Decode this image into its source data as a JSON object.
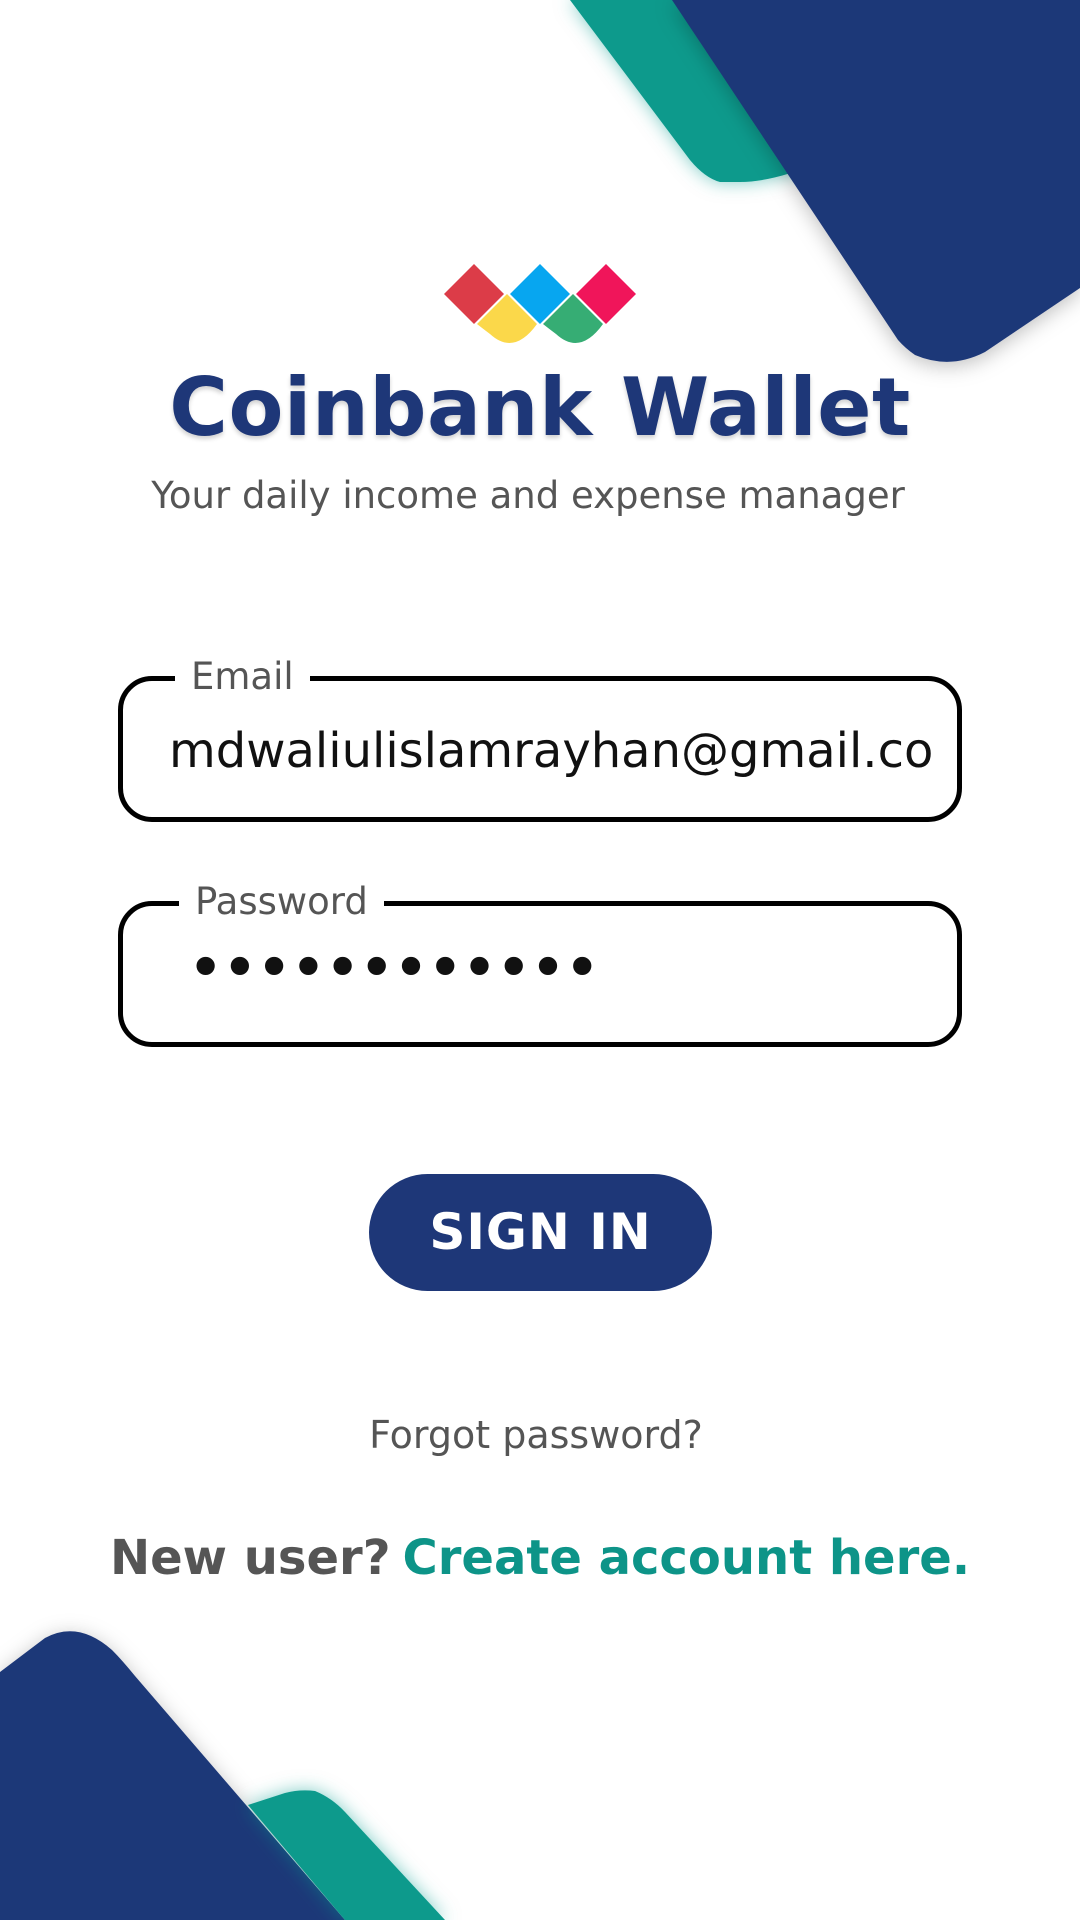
{
  "app": {
    "title": "Coinbank Wallet",
    "subtitle": "Your daily income and expense manager"
  },
  "form": {
    "email_label": "Email",
    "email_value": "mdwaliulislamrayhan@gmail.com",
    "password_label": "Password",
    "password_value": "••••••••••••"
  },
  "actions": {
    "signin_label": "SIGN IN",
    "forgot_label": "Forgot password?",
    "new_user_text": "New user?",
    "create_account_label": "Create account here."
  },
  "colors": {
    "brand_navy": "#1e3778",
    "accent_teal": "#089a8c",
    "logo_red": "#dc3c48",
    "logo_blue": "#07a6f0",
    "logo_pink": "#f0155a",
    "logo_yellow": "#fbd84a",
    "logo_green": "#36ad74"
  },
  "icons": {
    "logo": "coinbank-diamond-logo"
  }
}
